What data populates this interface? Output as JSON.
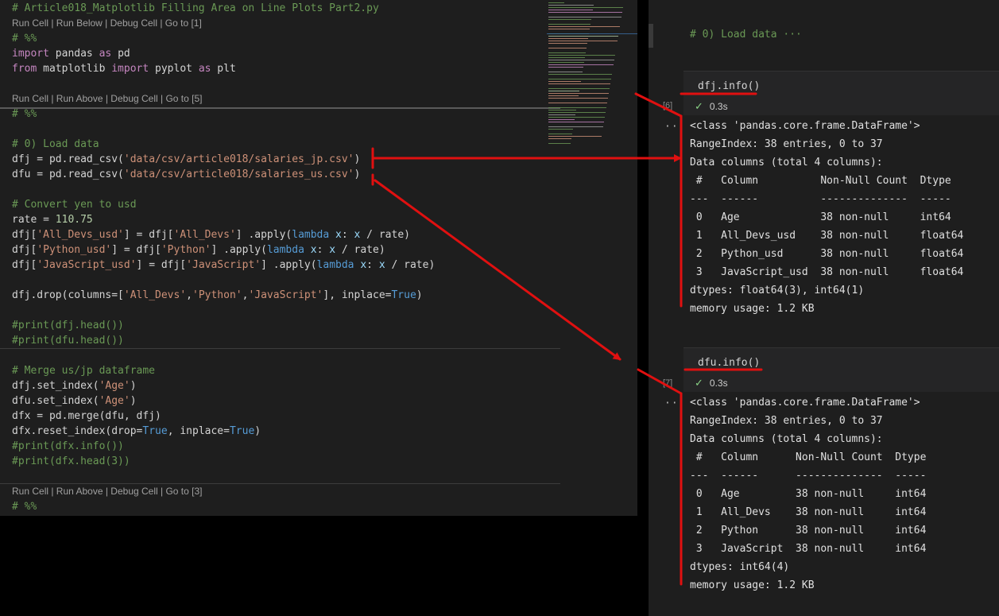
{
  "editor": {
    "lines": [
      {
        "t": "cmt",
        "text": "# Article018_Matplotlib Filling Area on Line Plots Part2.py"
      },
      {
        "t": "lens",
        "text": "Run Cell | Run Below | Debug Cell | Go to [1]"
      },
      {
        "t": "cmt",
        "text": "# %%"
      },
      {
        "t": "code",
        "parts": [
          [
            "kw",
            "import"
          ],
          [
            "plain",
            " pandas "
          ],
          [
            "kw",
            "as"
          ],
          [
            "plain",
            " pd"
          ]
        ]
      },
      {
        "t": "code",
        "parts": [
          [
            "kw",
            "from"
          ],
          [
            "plain",
            " matplotlib "
          ],
          [
            "kw",
            "import"
          ],
          [
            "plain",
            " pyplot "
          ],
          [
            "kw",
            "as"
          ],
          [
            "plain",
            " plt"
          ]
        ]
      },
      {
        "t": "blank"
      },
      {
        "t": "lens",
        "text": "Run Cell | Run Above | Debug Cell | Go to [5]"
      },
      {
        "t": "cmt",
        "text": "# %%"
      },
      {
        "t": "blank"
      },
      {
        "t": "cmt",
        "text": "# 0) Load data"
      },
      {
        "t": "code",
        "parts": [
          [
            "plain",
            "dfj = pd.read_csv("
          ],
          [
            "str",
            "'data/csv/article018/salaries_jp.csv'"
          ],
          [
            "plain",
            ")"
          ]
        ]
      },
      {
        "t": "code",
        "parts": [
          [
            "plain",
            "dfu = pd.read_csv("
          ],
          [
            "str",
            "'data/csv/article018/salaries_us.csv'"
          ],
          [
            "plain",
            ")"
          ]
        ]
      },
      {
        "t": "blank"
      },
      {
        "t": "cmt",
        "text": "# Convert yen to usd"
      },
      {
        "t": "code",
        "parts": [
          [
            "plain",
            "rate = "
          ],
          [
            "num",
            "110.75"
          ]
        ]
      },
      {
        "t": "code",
        "parts": [
          [
            "plain",
            "dfj["
          ],
          [
            "str",
            "'All_Devs_usd'"
          ],
          [
            "plain",
            "] = dfj["
          ],
          [
            "str",
            "'All_Devs'"
          ],
          [
            "plain",
            "] .apply("
          ],
          [
            "bi",
            "lambda"
          ],
          [
            "plain",
            " "
          ],
          [
            "var",
            "x"
          ],
          [
            "plain",
            ": "
          ],
          [
            "var",
            "x"
          ],
          [
            "plain",
            " / rate)"
          ]
        ]
      },
      {
        "t": "code",
        "parts": [
          [
            "plain",
            "dfj["
          ],
          [
            "str",
            "'Python_usd'"
          ],
          [
            "plain",
            "] = dfj["
          ],
          [
            "str",
            "'Python'"
          ],
          [
            "plain",
            "] .apply("
          ],
          [
            "bi",
            "lambda"
          ],
          [
            "plain",
            " "
          ],
          [
            "var",
            "x"
          ],
          [
            "plain",
            ": "
          ],
          [
            "var",
            "x"
          ],
          [
            "plain",
            " / rate)"
          ]
        ]
      },
      {
        "t": "code",
        "parts": [
          [
            "plain",
            "dfj["
          ],
          [
            "str",
            "'JavaScript_usd'"
          ],
          [
            "plain",
            "] = dfj["
          ],
          [
            "str",
            "'JavaScript'"
          ],
          [
            "plain",
            "] .apply("
          ],
          [
            "bi",
            "lambda"
          ],
          [
            "plain",
            " "
          ],
          [
            "var",
            "x"
          ],
          [
            "plain",
            ": "
          ],
          [
            "var",
            "x"
          ],
          [
            "plain",
            " / rate)"
          ]
        ]
      },
      {
        "t": "blank"
      },
      {
        "t": "code",
        "parts": [
          [
            "plain",
            "dfj.drop(columns=["
          ],
          [
            "str",
            "'All_Devs'"
          ],
          [
            "plain",
            ","
          ],
          [
            "str",
            "'Python'"
          ],
          [
            "plain",
            ","
          ],
          [
            "str",
            "'JavaScript'"
          ],
          [
            "plain",
            "], inplace="
          ],
          [
            "bi",
            "True"
          ],
          [
            "plain",
            ")"
          ]
        ]
      },
      {
        "t": "blank"
      },
      {
        "t": "cmt",
        "text": "#print(dfj.head())"
      },
      {
        "t": "cmt",
        "text": "#print(dfu.head())"
      },
      {
        "t": "blank"
      },
      {
        "t": "cmt",
        "text": "# Merge us/jp dataframe"
      },
      {
        "t": "code",
        "parts": [
          [
            "plain",
            "dfj.set_index("
          ],
          [
            "str",
            "'Age'"
          ],
          [
            "plain",
            ")"
          ]
        ]
      },
      {
        "t": "code",
        "parts": [
          [
            "plain",
            "dfu.set_index("
          ],
          [
            "str",
            "'Age'"
          ],
          [
            "plain",
            ")"
          ]
        ]
      },
      {
        "t": "code",
        "parts": [
          [
            "plain",
            "dfx = pd.merge(dfu, dfj)"
          ]
        ]
      },
      {
        "t": "code",
        "parts": [
          [
            "plain",
            "dfx.reset_index(drop="
          ],
          [
            "bi",
            "True"
          ],
          [
            "plain",
            ", inplace="
          ],
          [
            "bi",
            "True"
          ],
          [
            "plain",
            ")"
          ]
        ]
      },
      {
        "t": "cmt",
        "text": "#print(dfx.info())"
      },
      {
        "t": "cmt",
        "text": "#print(dfx.head(3))"
      },
      {
        "t": "blank"
      },
      {
        "t": "lens",
        "text": "Run Cell | Run Above | Debug Cell | Go to [3]"
      },
      {
        "t": "cmt",
        "text": "# %%"
      }
    ]
  },
  "notebook": {
    "markdown_title": "# 0) Load data ···",
    "cells": [
      {
        "source": "dfj.info()",
        "exec_count": "[6]",
        "status_icon": "check-icon",
        "status_time": "0.3s",
        "output_more": "···",
        "output": [
          "<class 'pandas.core.frame.DataFrame'>",
          "RangeIndex: 38 entries, 0 to 37",
          "Data columns (total 4 columns):",
          " #   Column          Non-Null Count  Dtype",
          "---  ------          --------------  -----",
          " 0   Age             38 non-null     int64",
          " 1   All_Devs_usd    38 non-null     float64",
          " 2   Python_usd      38 non-null     float64",
          " 3   JavaScript_usd  38 non-null     float64",
          "dtypes: float64(3), int64(1)",
          "memory usage: 1.2 KB"
        ]
      },
      {
        "source": "dfu.info()",
        "exec_count": "[7]",
        "status_icon": "check-icon",
        "status_time": "0.3s",
        "output_more": "···",
        "output": [
          "<class 'pandas.core.frame.DataFrame'>",
          "RangeIndex: 38 entries, 0 to 37",
          "Data columns (total 4 columns):",
          " #   Column      Non-Null Count  Dtype",
          "---  ------      --------------  -----",
          " 0   Age         38 non-null     int64",
          " 1   All_Devs    38 non-null     int64",
          " 2   Python      38 non-null     int64",
          " 3   JavaScript  38 non-null     int64",
          "dtypes: int64(4)",
          "memory usage: 1.2 KB"
        ]
      }
    ]
  },
  "colors": {
    "annotation": "#e01010",
    "comment": "#6a9955",
    "keyword": "#c586c0",
    "string": "#ce9178",
    "number": "#b5cea8",
    "builtin": "#569cd6",
    "background": "#1e1e1e"
  }
}
